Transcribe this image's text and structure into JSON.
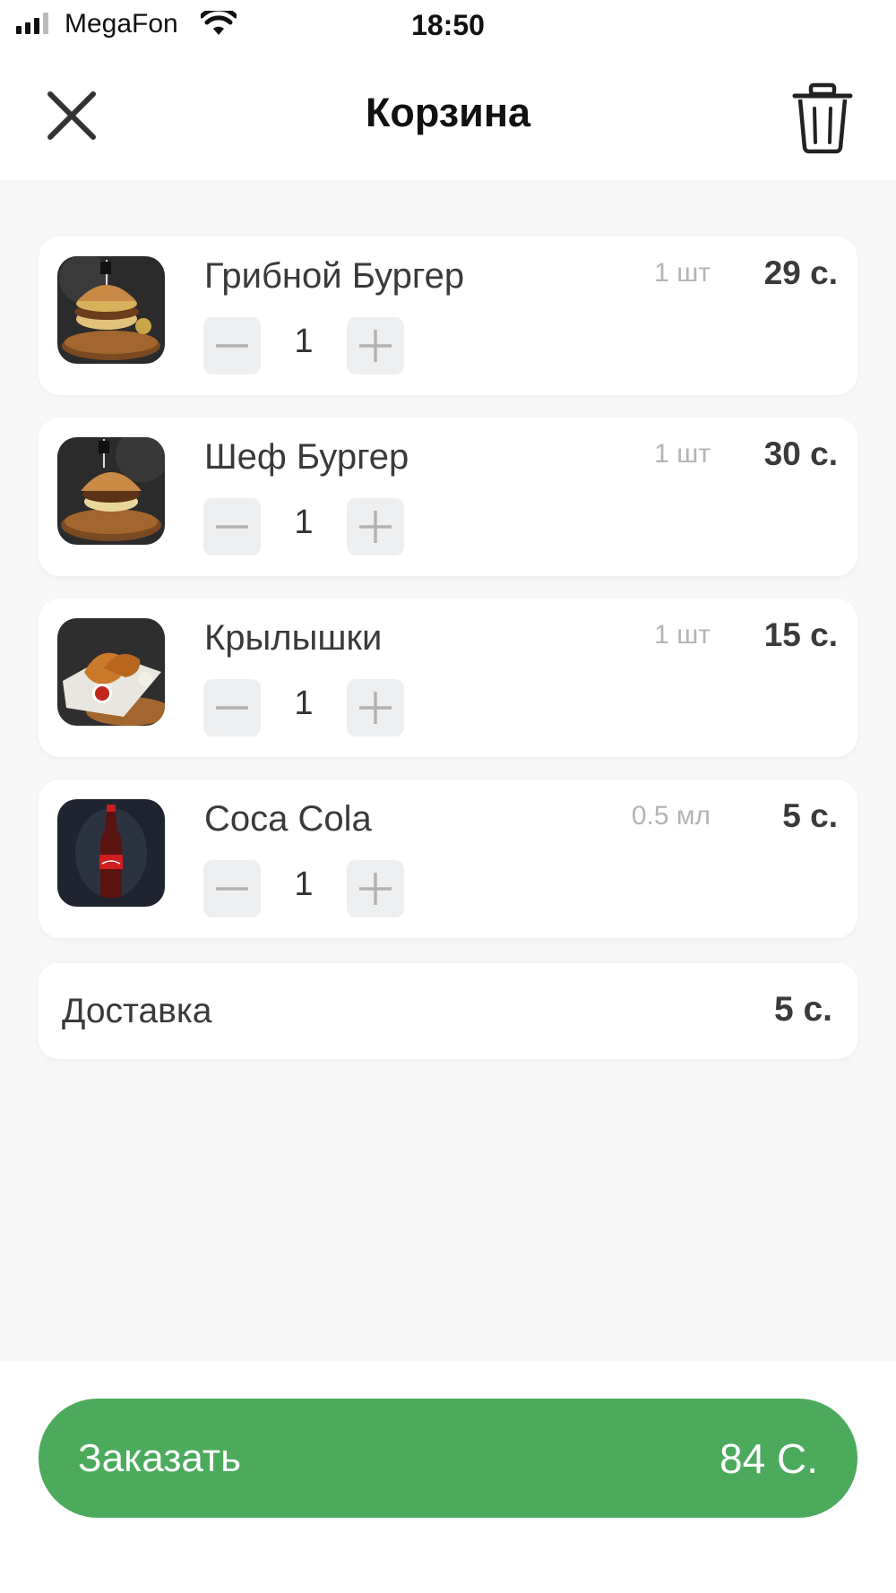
{
  "status_bar": {
    "carrier": "MegaFon",
    "time": "18:50"
  },
  "header": {
    "title": "Корзина",
    "icons": {
      "close": "close-icon",
      "trash": "trash-icon"
    }
  },
  "cart": {
    "items": [
      {
        "name": "Грибной Бургер",
        "unit": "1 шт",
        "price": "29 с.",
        "quantity": "1",
        "image": "mushroom-burger"
      },
      {
        "name": "Шеф Бургер",
        "unit": "1 шт",
        "price": "30 с.",
        "quantity": "1",
        "image": "chef-burger"
      },
      {
        "name": "Крылышки",
        "unit": "1 шт",
        "price": "15 с.",
        "quantity": "1",
        "image": "chicken-wings"
      },
      {
        "name": "Coca Cola",
        "unit": "0.5 мл",
        "price": "5 с.",
        "quantity": "1",
        "image": "coca-cola-bottle"
      }
    ],
    "delivery": {
      "label": "Доставка",
      "price": "5 с."
    }
  },
  "order_button": {
    "label": "Заказать",
    "total": "84 С."
  },
  "colors": {
    "accent_green": "#4caa5c",
    "background": "#f7f7f7",
    "card": "#ffffff",
    "stepper_bg": "#eeeff1",
    "muted_text": "#b4b4b4"
  }
}
